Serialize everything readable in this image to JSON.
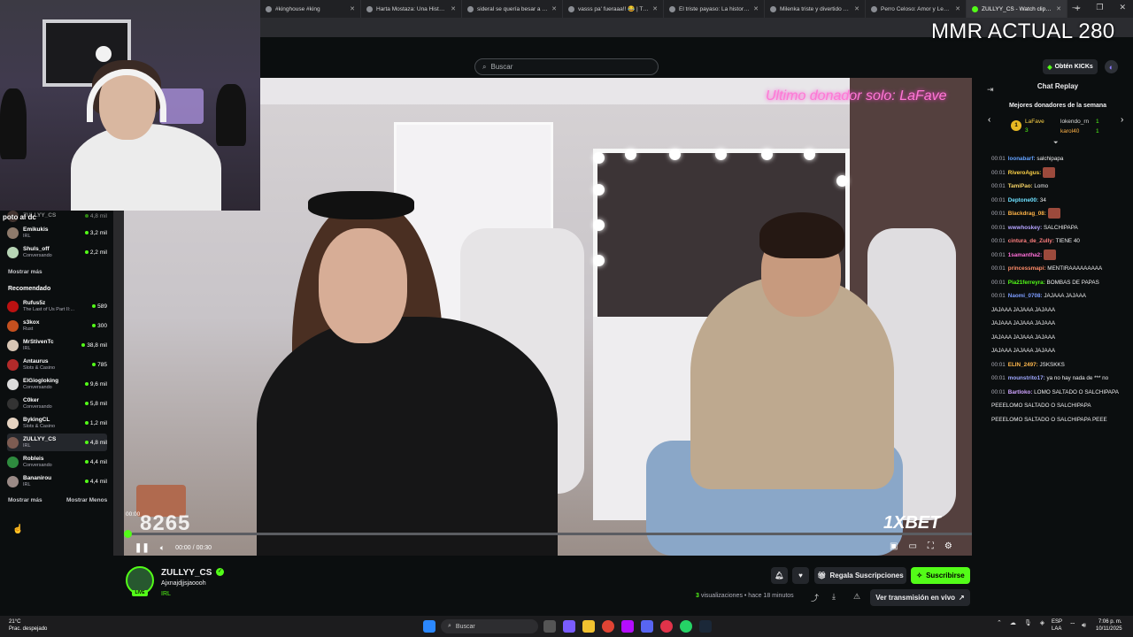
{
  "browser": {
    "tabs": [
      {
        "label": "#kinghouse #king"
      },
      {
        "label": "Harta Mostaza: Una Historia d"
      },
      {
        "label": "sideral se quería besar a rusa"
      },
      {
        "label": "vasss pa' fueraaa!! 😂 | TikTok"
      },
      {
        "label": "El triste payaso: La historia de"
      },
      {
        "label": "Milenka triste y divertido en c"
      },
      {
        "label": "Perro Celoso: Amor y Lealtad"
      },
      {
        "label": "ZULLYY_CS - Watch clips o"
      }
    ],
    "new_tab": "+"
  },
  "overlay_text": "MMR ACTUAL 280",
  "topnav": {
    "search_placeholder": "Buscar",
    "get_kicks": "Obtén KICKs"
  },
  "sidebar": {
    "partial_label": "poto al dc",
    "partial_top": {
      "name": "ZULLYY_CS",
      "viewers": "4,8 mil"
    },
    "following": [
      {
        "name": "Emikukis",
        "category": "IRL",
        "viewers": "3,2 mil",
        "color": "#8e7a6b"
      },
      {
        "name": "Shuls_off",
        "category": "Conversando",
        "viewers": "2,2 mil",
        "color": "#b7d5b5"
      }
    ],
    "show_more": "Mostrar más",
    "recommended_title": "Recomendado",
    "recommended": [
      {
        "name": "Rufus5z",
        "category": "The Last of Us Part II:...",
        "viewers": "589",
        "color": "#b11"
      },
      {
        "name": "s3kox",
        "category": "Rust",
        "viewers": "300",
        "color": "#c4501f"
      },
      {
        "name": "MrStivenTc",
        "category": "IRL",
        "viewers": "38,8 mil",
        "color": "#d8c6b5"
      },
      {
        "name": "Antaurus",
        "category": "Slots & Casino",
        "viewers": "785",
        "color": "#b32a2a"
      },
      {
        "name": "ElGiogloking",
        "category": "Conversando",
        "viewers": "9,6 mil",
        "color": "#dcdcdc"
      },
      {
        "name": "C0ker",
        "category": "Conversando",
        "viewers": "5,8 mil",
        "color": "#333"
      },
      {
        "name": "BykingCL",
        "category": "Slots & Casino",
        "viewers": "1,2 mil",
        "color": "#e7d4c2"
      },
      {
        "name": "ZULLYY_CS",
        "category": "IRL",
        "viewers": "4,8 mil",
        "color": "#7d5c52",
        "selected": true
      },
      {
        "name": "Robleis",
        "category": "Conversando",
        "viewers": "4,4 mil",
        "color": "#2e8b3e"
      },
      {
        "name": "Bananirou",
        "category": "IRL",
        "viewers": "4,4 mil",
        "color": "#9a8a86"
      }
    ],
    "show_more_2": "Mostrar más",
    "show_less": "Mostrar Menos"
  },
  "video": {
    "neon_sign": "Ultimo donador solo: LaFave",
    "watermark_digits": "8265",
    "top_time": "00:00",
    "current_time": "00:00",
    "duration": "00:30",
    "time_separator": "/",
    "sponsor": "1XBET",
    "progress": 0.0
  },
  "chat": {
    "title": "Chat Replay",
    "donors_title": "Mejores donadores de la semana",
    "donors": [
      {
        "name": "LaFave",
        "amount": "3",
        "rank": "1"
      },
      {
        "name": "lokendo_rn",
        "amount": "1"
      },
      {
        "name": "karol40",
        "amount": "1"
      }
    ],
    "messages": [
      {
        "time": "00:01",
        "user": "loonabarf",
        "color": "#63a2ff",
        "text": "salchipapa"
      },
      {
        "time": "00:01",
        "user": "RiveroAgus",
        "color": "#ffd447",
        "text": "",
        "emotes": 1
      },
      {
        "time": "00:01",
        "user": "TamiPao",
        "color": "#f6d365",
        "text": "Lomo"
      },
      {
        "time": "00:01",
        "user": "Deptone00",
        "color": "#6ce0ff",
        "text": "34"
      },
      {
        "time": "00:01",
        "user": "Blackdrag_08",
        "color": "#ffb347",
        "text": "",
        "emotes": 1
      },
      {
        "time": "00:01",
        "user": "wwwhoskey",
        "color": "#b4a3ff",
        "text": "SALCHIPAPA"
      },
      {
        "time": "00:01",
        "user": "cintura_de_Zully",
        "color": "#ff7f7f",
        "text": "TIENE 40"
      },
      {
        "time": "00:01",
        "user": "1samantha2",
        "color": "#ff6fd8",
        "text": "",
        "emotes": 1
      },
      {
        "time": "00:01",
        "user": "princessmapi",
        "color": "#ff8c69",
        "text": "MENTIRAAAAAAAAA"
      },
      {
        "time": "00:01",
        "user": "Pia21ferreyra",
        "color": "#53fc18",
        "text": "BOMBAS DE PAPAS"
      },
      {
        "time": "00:01",
        "user": "Naomi_0708",
        "color": "#7c9cff",
        "text": "JAJAAA JAJAAA"
      },
      {
        "time": "",
        "user": "",
        "color": "#fff",
        "text": "JAJAAA JAJAAA JAJAAA"
      },
      {
        "time": "",
        "user": "",
        "color": "#fff",
        "text": "JAJAAA JAJAAA JAJAAA"
      },
      {
        "time": "",
        "user": "",
        "color": "#fff",
        "text": "JAJAAA JAJAAA JAJAAA"
      },
      {
        "time": "",
        "user": "",
        "color": "#fff",
        "text": "JAJAAA JAJAAA JAJAAA"
      },
      {
        "time": "00:01",
        "user": "ELIN_2497",
        "color": "#ffb84d",
        "text": "JSKSKKS"
      },
      {
        "time": "00:01",
        "user": "mounstrito17",
        "color": "#9fa8ff",
        "text": "ya no hay nada de *** no"
      },
      {
        "time": "00:01",
        "user": "Bartloko",
        "color": "#cfa3ff",
        "text": "LOMO SALTADO O SALCHIPAPA"
      },
      {
        "time": "",
        "user": "",
        "color": "#fff",
        "text": "PEEELOMO SALTADO O SALCHIPAPA"
      },
      {
        "time": "",
        "user": "",
        "color": "#fff",
        "text": "PEEELOMO SALTADO O SALCHIPAPA PEEE"
      }
    ]
  },
  "streamer": {
    "name": "ZULLYY_CS",
    "title": "Ajxnajdjjsjaoooh",
    "category": "IRL",
    "live_badge": "LIVE",
    "views_count": "3",
    "views_text": "visualizaciones",
    "ago": "• hace 18 minutos",
    "gift_subs": "Regala Suscripciones",
    "subscribe": "Suscribirse",
    "watch_live": "Ver transmisión en vivo"
  },
  "taskbar": {
    "temp": "21°C",
    "weather": "Prac. despejado",
    "search": "Buscar",
    "lang1": "ESP",
    "lang2": "LAA",
    "time": "7:06 p. m.",
    "date": "10/11/2025"
  },
  "colors": {
    "accent": "#53fc18",
    "bg": "#0b0e0f"
  }
}
